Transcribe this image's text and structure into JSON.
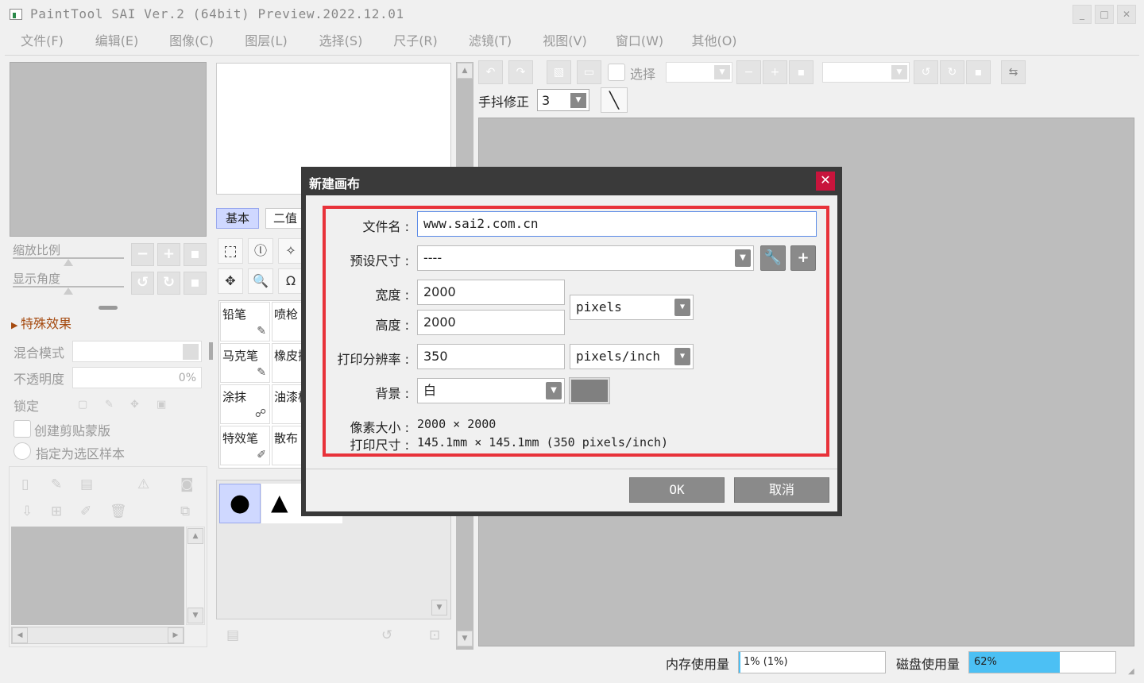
{
  "window": {
    "title": "PaintTool SAI Ver.2 (64bit) Preview.2022.12.01",
    "controls": [
      "_",
      "□",
      "✕"
    ]
  },
  "menu": [
    "文件(F)",
    "编辑(E)",
    "图像(C)",
    "图层(L)",
    "选择(S)",
    "尺子(R)",
    "滤镜(T)",
    "视图(V)",
    "窗口(W)",
    "其他(O)"
  ],
  "left_panel": {
    "zoom_label": "缩放比例",
    "angle_label": "显示角度",
    "effects_label": "特殊效果",
    "blend_label": "混合模式",
    "opacity_label": "不透明度",
    "opacity_value": "0%",
    "lock_label": "锁定",
    "clip_label": "创建剪贴蒙版",
    "selection_source_label": "指定为选区样本"
  },
  "tool_panel": {
    "tabs": [
      "基本",
      "二值"
    ],
    "brushes": [
      {
        "name": "铅笔",
        "icon": "pencil-icon"
      },
      {
        "name": "喷枪",
        "icon": ""
      },
      {
        "name": "马克笔",
        "icon": "marker-icon"
      },
      {
        "name": "橡皮擦",
        "icon": ""
      },
      {
        "name": "涂抹",
        "icon": "smudge-icon"
      },
      {
        "name": "油漆桶",
        "icon": ""
      },
      {
        "name": "特效笔",
        "icon": "effect-pen-icon"
      },
      {
        "name": "散布",
        "icon": ""
      }
    ]
  },
  "canvas_toolbar": {
    "select_label": "选择",
    "stabilizer_label": "手抖修正",
    "stabilizer_value": "3"
  },
  "status": {
    "memory_label": "内存使用量",
    "memory_value": "1% (1%)",
    "memory_percent": 1,
    "disk_label": "磁盘使用量",
    "disk_value": "62%",
    "disk_percent": 62,
    "disk_color": "#4cc0f4"
  },
  "dialog": {
    "title": "新建画布",
    "close": "✕",
    "filename_label": "文件名 :",
    "filename_value": "www.sai2.com.cn",
    "preset_label": "预设尺寸 :",
    "preset_value": "----",
    "width_label": "宽度 :",
    "width_value": "2000",
    "height_label": "高度 :",
    "height_value": "2000",
    "size_unit": "pixels",
    "resolution_label": "打印分辨率 :",
    "resolution_value": "350",
    "resolution_unit": "pixels/inch",
    "background_label": "背景 :",
    "background_value": "白",
    "background_color": "#808080",
    "pixel_size_label": "像素大小 :",
    "pixel_size_value": "2000 × 2000",
    "print_size_label": "打印尺寸 :",
    "print_size_value": "145.1mm × 145.1mm (350 pixels/inch)",
    "ok_label": "OK",
    "cancel_label": "取消",
    "highlight_color": "#e8323a"
  }
}
